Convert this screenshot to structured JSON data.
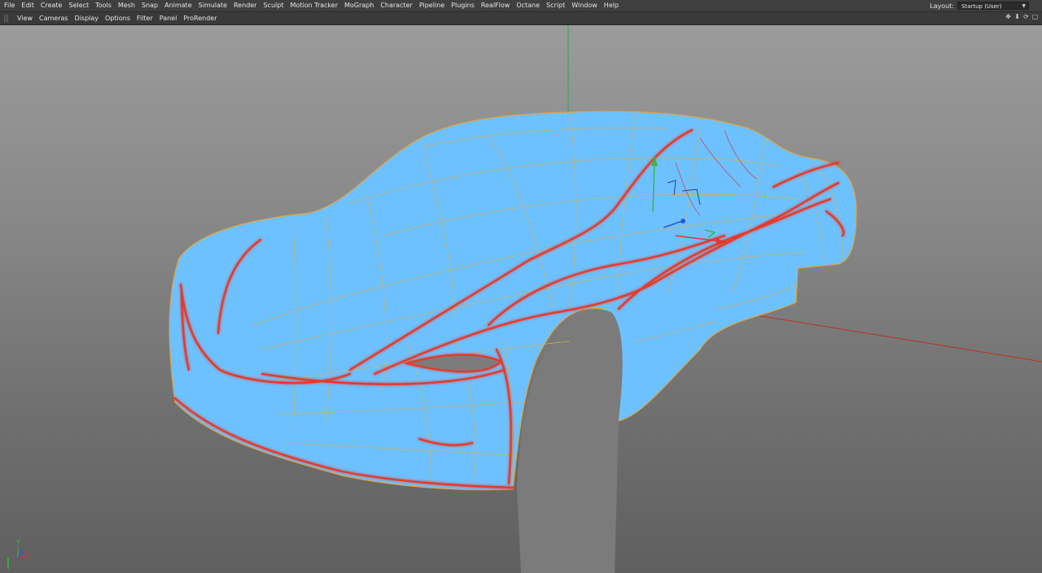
{
  "menubar": {
    "items": [
      "File",
      "Edit",
      "Create",
      "Select",
      "Tools",
      "Mesh",
      "Snap",
      "Animate",
      "Simulate",
      "Render",
      "Sculpt",
      "Motion Tracker",
      "MoGraph",
      "Character",
      "Pipeline",
      "Plugins",
      "RealFlow",
      "Octane",
      "Script",
      "Window",
      "Help"
    ],
    "layout_label": "Layout:",
    "layout_value": "Startup (User)"
  },
  "viewbar": {
    "items": [
      "View",
      "Cameras",
      "Display",
      "Options",
      "Filter",
      "Panel",
      "ProRender"
    ],
    "icons": [
      "move-view-icon",
      "zoom-view-icon",
      "rotate-view-icon",
      "maximize-view-icon"
    ]
  },
  "viewport": {
    "model_color": "#6ec1ff",
    "wire_color": "#d8b24a",
    "edge_color": "#e53a2a",
    "axis_colors": {
      "x": "#e0362b",
      "y": "#39b54a",
      "z": "#2c55e0"
    },
    "axis_labels": {
      "x": "X",
      "y": "Y",
      "z": "Z"
    }
  }
}
